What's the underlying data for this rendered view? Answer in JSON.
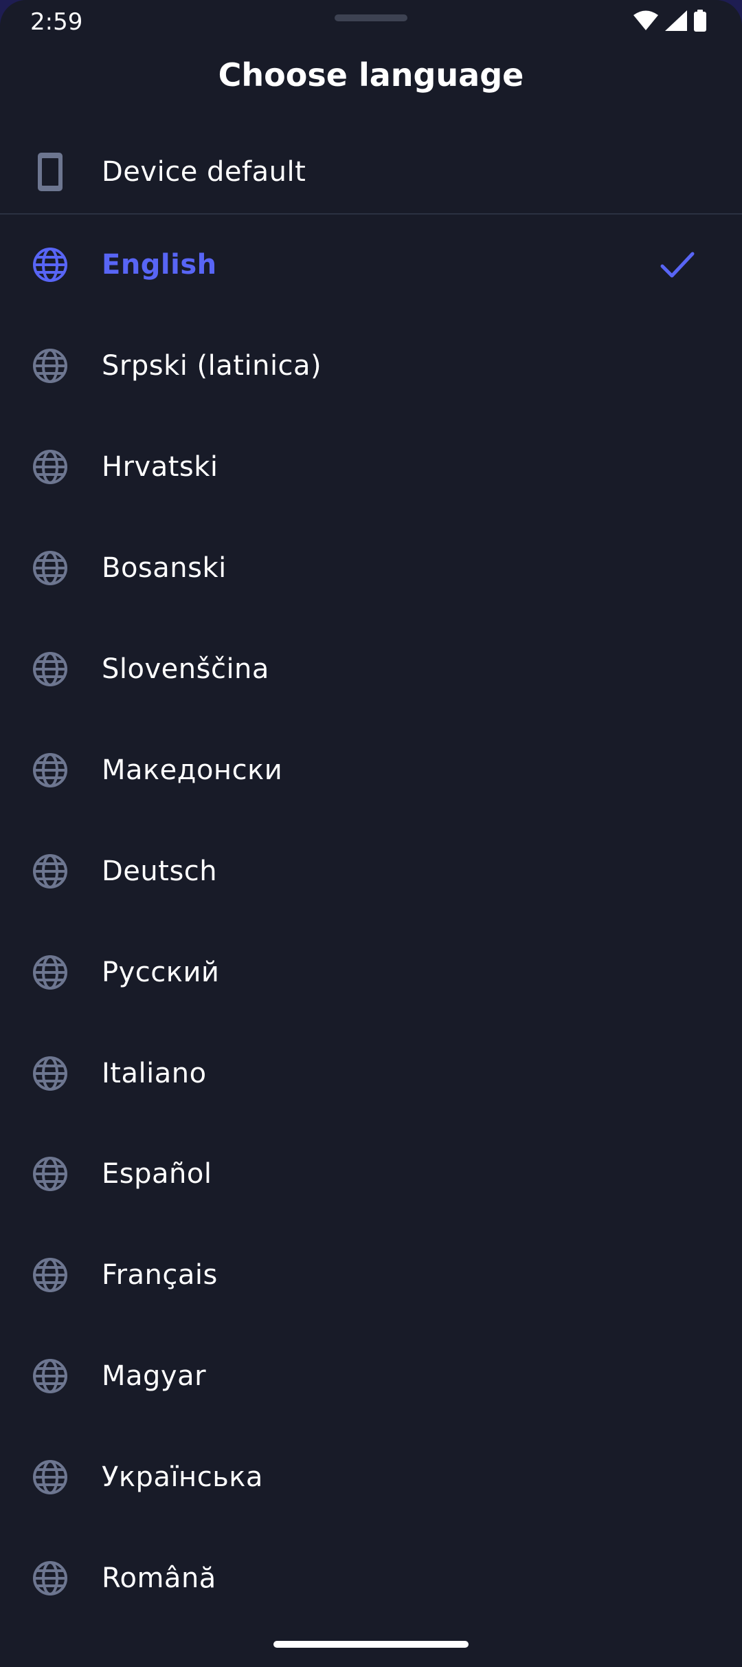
{
  "status_bar": {
    "time": "2:59"
  },
  "header": {
    "title": "Choose language"
  },
  "device_default": {
    "label": "Device default",
    "icon": "phone-icon"
  },
  "colors": {
    "background": "#181b28",
    "accent": "#5865f5",
    "icon_gray": "#6d7690",
    "text": "#ffffff"
  },
  "languages": [
    {
      "label": "English",
      "selected": true,
      "icon": "globe-icon"
    },
    {
      "label": "Srpski (latinica)",
      "selected": false,
      "icon": "globe-icon"
    },
    {
      "label": "Hrvatski",
      "selected": false,
      "icon": "globe-icon"
    },
    {
      "label": "Bosanski",
      "selected": false,
      "icon": "globe-icon"
    },
    {
      "label": "Slovenščina",
      "selected": false,
      "icon": "globe-icon"
    },
    {
      "label": "Македонски",
      "selected": false,
      "icon": "globe-icon"
    },
    {
      "label": "Deutsch",
      "selected": false,
      "icon": "globe-icon"
    },
    {
      "label": "Русский",
      "selected": false,
      "icon": "globe-icon"
    },
    {
      "label": "Italiano",
      "selected": false,
      "icon": "globe-icon"
    },
    {
      "label": "Español",
      "selected": false,
      "icon": "globe-icon"
    },
    {
      "label": "Français",
      "selected": false,
      "icon": "globe-icon"
    },
    {
      "label": "Magyar",
      "selected": false,
      "icon": "globe-icon"
    },
    {
      "label": "Українська",
      "selected": false,
      "icon": "globe-icon"
    },
    {
      "label": "Română",
      "selected": false,
      "icon": "globe-icon"
    }
  ]
}
